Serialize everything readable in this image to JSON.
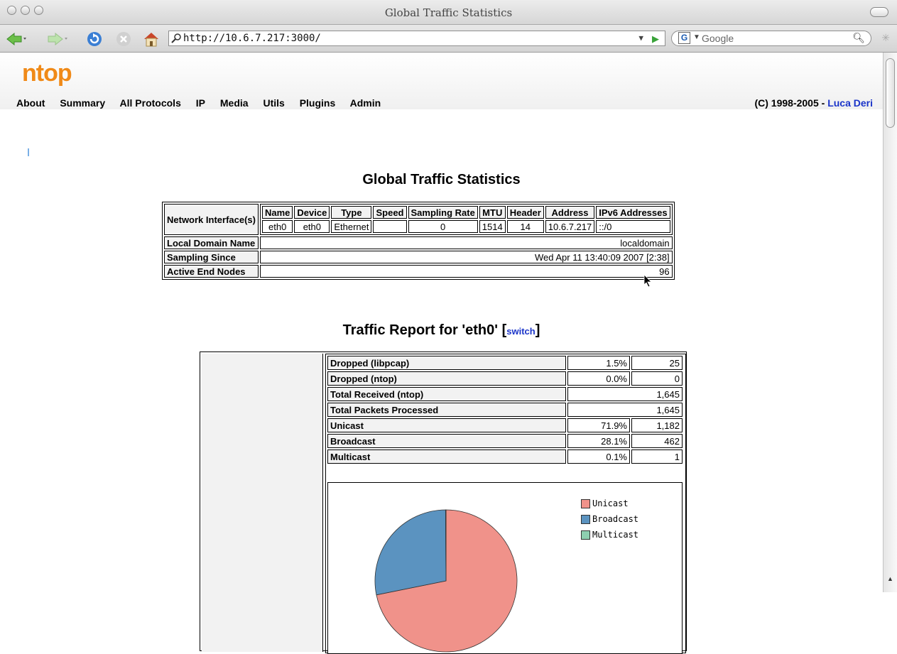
{
  "window": {
    "title": "Global Traffic Statistics"
  },
  "browser": {
    "url": "http://10.6.7.217:3000/",
    "search_placeholder": "Google"
  },
  "header": {
    "logo": "ntop",
    "menu": [
      "About",
      "Summary",
      "All Protocols",
      "IP",
      "Media",
      "Utils",
      "Plugins",
      "Admin"
    ],
    "copyright_prefix": "(C) 1998-2005 - ",
    "copyright_author": "Luca Deri"
  },
  "global": {
    "title": "Global Traffic Statistics",
    "network_interfaces_label": "Network Interface(s)",
    "iface_headers": [
      "Name",
      "Device",
      "Type",
      "Speed",
      "Sampling Rate",
      "MTU",
      "Header",
      "Address",
      "IPv6 Addresses"
    ],
    "iface_row": [
      "eth0",
      "eth0",
      "Ethernet",
      "",
      "0",
      "1514",
      "14",
      "10.6.7.217",
      "::/0"
    ],
    "local_domain_label": "Local Domain Name",
    "local_domain_value": "localdomain",
    "sampling_since_label": "Sampling Since",
    "sampling_since_value": "Wed Apr 11 13:40:09 2007 [2:38]",
    "active_nodes_label": "Active End Nodes",
    "active_nodes_value": "96"
  },
  "report": {
    "title": "Traffic Report for 'eth0' [",
    "switch": "switch",
    "title_end": "]",
    "rows": [
      {
        "label": "Dropped (libpcap)",
        "pct": "1.5%",
        "count": "25"
      },
      {
        "label": "Dropped (ntop)",
        "pct": "0.0%",
        "count": "0"
      },
      {
        "label": "Total Received (ntop)",
        "pct": "",
        "count": "1,645"
      },
      {
        "label": "Total Packets Processed",
        "pct": "",
        "count": "1,645"
      },
      {
        "label": "Unicast",
        "pct": "71.9%",
        "count": "1,182"
      },
      {
        "label": "Broadcast",
        "pct": "28.1%",
        "count": "462"
      },
      {
        "label": "Multicast",
        "pct": "0.1%",
        "count": "1"
      }
    ]
  },
  "chart_data": {
    "type": "pie",
    "categories": [
      "Unicast",
      "Broadcast",
      "Multicast"
    ],
    "values": [
      71.9,
      28.1,
      0.1
    ],
    "colors": [
      "#f0928a",
      "#5b93c0",
      "#8ecfb0"
    ],
    "legend_position": "top-right"
  }
}
